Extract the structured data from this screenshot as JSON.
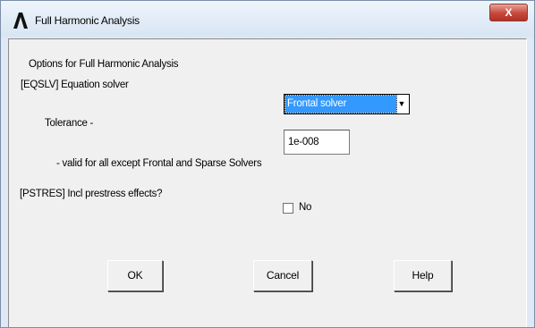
{
  "window": {
    "title": "Full Harmonic Analysis",
    "close_label": "X"
  },
  "form": {
    "section_title": "Options for Full Harmonic Analysis",
    "eqslv_label": "[EQSLV]  Equation solver",
    "eqslv_value": "Frontal solver",
    "tolerance_label": "Tolerance -",
    "tolerance_value": "1e-008",
    "valid_note": "- valid for all except Frontal and Sparse Solvers",
    "pstres_label": "[PSTRES] Incl prestress effects?",
    "pstres_checked": false,
    "pstres_checkbox_label": "No"
  },
  "buttons": {
    "ok": "OK",
    "cancel": "Cancel",
    "help": "Help"
  },
  "colors": {
    "selection": "#3399ff",
    "close_button": "#c7473b",
    "dialog_bg": "#f0f0f0"
  }
}
